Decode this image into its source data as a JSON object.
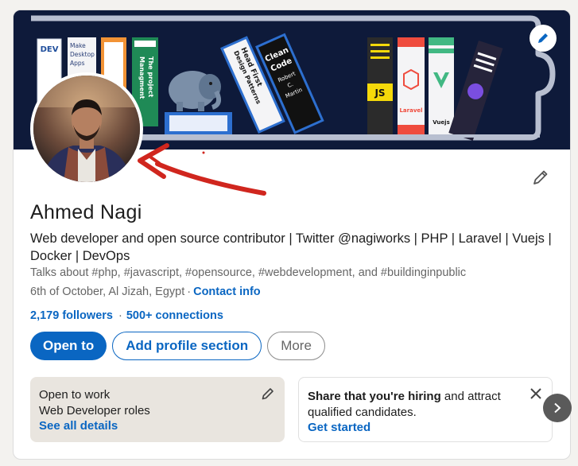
{
  "banner": {
    "book_texts": {
      "devops": "DEV",
      "make_apps": [
        "Make",
        "Desktop",
        "Apps"
      ],
      "project_mgmt": [
        "The project",
        "Managment"
      ],
      "head_first": [
        "Head First",
        "Design Patterns"
      ],
      "clean_code": [
        "Clean",
        "Code",
        "Robert",
        "C.",
        "Martin"
      ],
      "js": "JS",
      "laravel": "Laravel",
      "vuejs": "Vuejs"
    }
  },
  "profile": {
    "name": "Ahmed Nagi",
    "headline": "Web developer and open source contributor | Twitter @nagiworks | PHP | Laravel | Vuejs | Docker | DevOps",
    "talks_about": "Talks about #php, #javascript, #opensource, #webdevelopment, and #buildinginpublic",
    "location": "6th of October, Al Jizah, Egypt",
    "location_sep": "·",
    "contact_info": "Contact info",
    "followers": "2,179 followers",
    "stats_sep": "·",
    "connections": "500+ connections"
  },
  "actions": {
    "open_to": "Open to",
    "add_section": "Add profile section",
    "more": "More"
  },
  "open_to_work": {
    "title": "Open to work",
    "subtitle": "Web Developer roles",
    "link": "See all details"
  },
  "hiring": {
    "title_bold": "Share that you're hiring",
    "title_rest": " and attract qualified candidates.",
    "link": "Get started"
  },
  "icons": {
    "banner_edit": "pencil-icon",
    "profile_edit": "pencil-icon",
    "otw_edit": "pencil-icon",
    "close": "close-icon",
    "next": "chevron-right-icon"
  },
  "colors": {
    "accent": "#0a66c2",
    "banner_bg": "#0e1a3a",
    "annotation": "#d0261e"
  }
}
